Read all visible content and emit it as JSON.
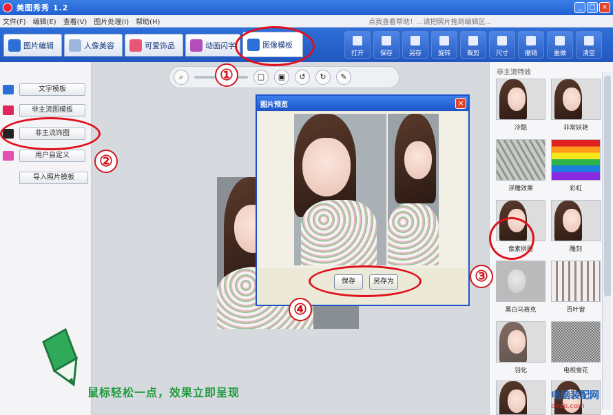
{
  "window": {
    "title": "美图秀秀 1.2"
  },
  "menubar": {
    "items": [
      "文件(F)",
      "编辑(E)",
      "查看(V)",
      "图片处理(I)",
      "帮助(H)"
    ],
    "hint": "点我查看帮助！...请把照片拖到编辑区..."
  },
  "tabs": [
    {
      "label": "图片编辑"
    },
    {
      "label": "人像美容"
    },
    {
      "label": "可爱饰品"
    },
    {
      "label": "动画闪字"
    },
    {
      "label": "图像模板"
    }
  ],
  "tools": [
    "打开",
    "保存",
    "另存",
    "旋转",
    "裁剪",
    "尺寸",
    "预览",
    "撤销",
    "重做",
    "清空"
  ],
  "left_panel": {
    "items": [
      "文字模板",
      "非主流图模板",
      "非主流饰图",
      "用户自定义",
      "导入照片模板"
    ]
  },
  "dialog": {
    "title": "图片预览",
    "buttons": {
      "save": "保存",
      "save_as": "另存为"
    }
  },
  "right_panel": {
    "header": "非主流特效",
    "effects": [
      "冷酷",
      "非常妖艳",
      "浮雕效果",
      "彩虹",
      "像素拼图",
      "雕刻",
      "黑白马赛克",
      "百叶窗",
      "羽化",
      "电视雪花",
      "",
      ""
    ]
  },
  "annotations": [
    "①",
    "②",
    "③",
    "④"
  ],
  "caption": "鼠标轻松一点，效果立即呈现",
  "watermark": {
    "line1": "电脑装配网",
    "line2": "dnzp.com"
  },
  "colors": {
    "accent": "#2058bf",
    "annotation": "#e0101a",
    "caption": "#1f9a3d"
  }
}
